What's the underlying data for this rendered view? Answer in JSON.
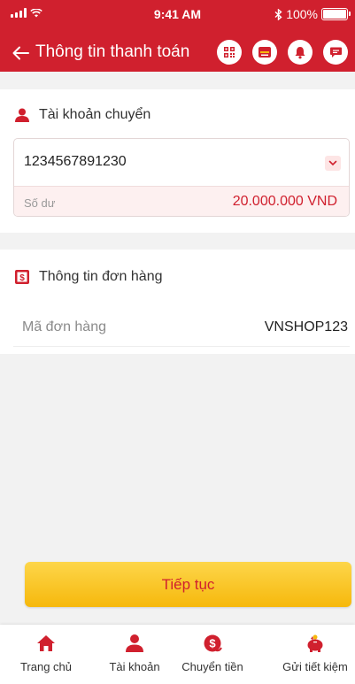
{
  "status_bar": {
    "time": "9:41 AM",
    "battery": "100%"
  },
  "header": {
    "title": "Thông tin thanh toán",
    "icons": [
      "qr-code-icon",
      "scan-icon",
      "bell-icon",
      "chat-icon"
    ]
  },
  "account_section": {
    "title": "Tài khoản chuyển",
    "account_number": "1234567891230",
    "balance_label": "Số dư",
    "balance_value": "20.000.000 VND"
  },
  "order_section": {
    "title": "Thông tin đơn hàng",
    "order_code_label": "Mã đơn hàng",
    "order_code_value": "VNSHOP123"
  },
  "continue_label": "Tiếp tục",
  "bottom_nav": {
    "items": [
      {
        "label": "Trang chủ",
        "icon": "home-icon"
      },
      {
        "label": "Tài khoản",
        "icon": "user-icon"
      },
      {
        "label": "Chuyển tiền",
        "icon": "money-transfer-icon"
      },
      {
        "label": "Gửi tiết kiệm",
        "icon": "piggy-bank-icon"
      }
    ]
  },
  "colors": {
    "primary": "#d0202e",
    "accent": "#f6b80c",
    "background": "#f2f2f2"
  }
}
